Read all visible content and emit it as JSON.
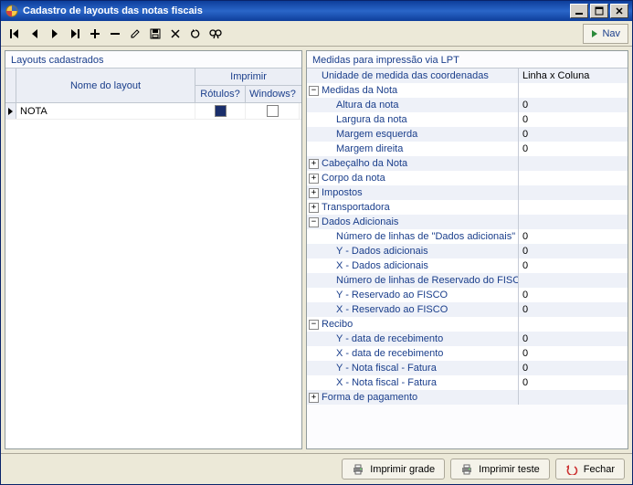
{
  "window": {
    "title": "Cadastro de layouts das notas fiscais"
  },
  "toolbar": {
    "nav_label": "Nav"
  },
  "left_panel": {
    "title": "Layouts cadastrados",
    "col_layout_name": "Nome do layout",
    "col_print_group": "Imprimir",
    "col_print_labels": "Rótulos?",
    "col_print_windows": "Windows?",
    "rows": [
      {
        "name": "NOTA",
        "labels_checked": false,
        "windows_checked": false
      }
    ]
  },
  "right_panel": {
    "title": "Medidas para impressão via LPT",
    "rows": [
      {
        "type": "leaf",
        "indent": 1,
        "label": "Unidade de medida das coordenadas",
        "value": "Linha x Coluna"
      },
      {
        "type": "group",
        "indent": 0,
        "expanded": true,
        "label": "Medidas da Nota",
        "value": ""
      },
      {
        "type": "leaf",
        "indent": 2,
        "label": "Altura da nota",
        "value": "0"
      },
      {
        "type": "leaf",
        "indent": 2,
        "label": "Largura da nota",
        "value": "0"
      },
      {
        "type": "leaf",
        "indent": 2,
        "label": "Margem esquerda",
        "value": "0"
      },
      {
        "type": "leaf",
        "indent": 2,
        "label": "Margem direita",
        "value": "0"
      },
      {
        "type": "group",
        "indent": 0,
        "expanded": false,
        "label": "Cabeçalho da Nota",
        "value": ""
      },
      {
        "type": "group",
        "indent": 0,
        "expanded": false,
        "label": "Corpo da nota",
        "value": ""
      },
      {
        "type": "group",
        "indent": 0,
        "expanded": false,
        "label": "Impostos",
        "value": ""
      },
      {
        "type": "group",
        "indent": 0,
        "expanded": false,
        "label": "Transportadora",
        "value": ""
      },
      {
        "type": "group",
        "indent": 0,
        "expanded": true,
        "label": "Dados Adicionais",
        "value": ""
      },
      {
        "type": "leaf",
        "indent": 2,
        "label": "Número de linhas de \"Dados adicionais\"",
        "value": "0"
      },
      {
        "type": "leaf",
        "indent": 2,
        "label": "Y -  Dados adicionais",
        "value": "0"
      },
      {
        "type": "leaf",
        "indent": 2,
        "label": "X - Dados adicionais",
        "value": "0"
      },
      {
        "type": "leaf",
        "indent": 2,
        "label": "Número de linhas de Reservado do FISCO",
        "value": ""
      },
      {
        "type": "leaf",
        "indent": 2,
        "label": "Y - Reservado ao FISCO",
        "value": "0"
      },
      {
        "type": "leaf",
        "indent": 2,
        "label": "X - Reservado ao FISCO",
        "value": "0"
      },
      {
        "type": "group",
        "indent": 0,
        "expanded": true,
        "label": "Recibo",
        "value": ""
      },
      {
        "type": "leaf",
        "indent": 2,
        "label": "Y - data de recebimento",
        "value": "0"
      },
      {
        "type": "leaf",
        "indent": 2,
        "label": "X - data de recebimento",
        "value": "0"
      },
      {
        "type": "leaf",
        "indent": 2,
        "label": "Y - Nota fiscal - Fatura",
        "value": "0"
      },
      {
        "type": "leaf",
        "indent": 2,
        "label": "X - Nota fiscal - Fatura",
        "value": "0"
      },
      {
        "type": "group",
        "indent": 0,
        "expanded": false,
        "label": "Forma de pagamento",
        "value": ""
      }
    ]
  },
  "footer": {
    "print_grid": "Imprimir grade",
    "print_test": "Imprimir teste",
    "close": "Fechar"
  }
}
